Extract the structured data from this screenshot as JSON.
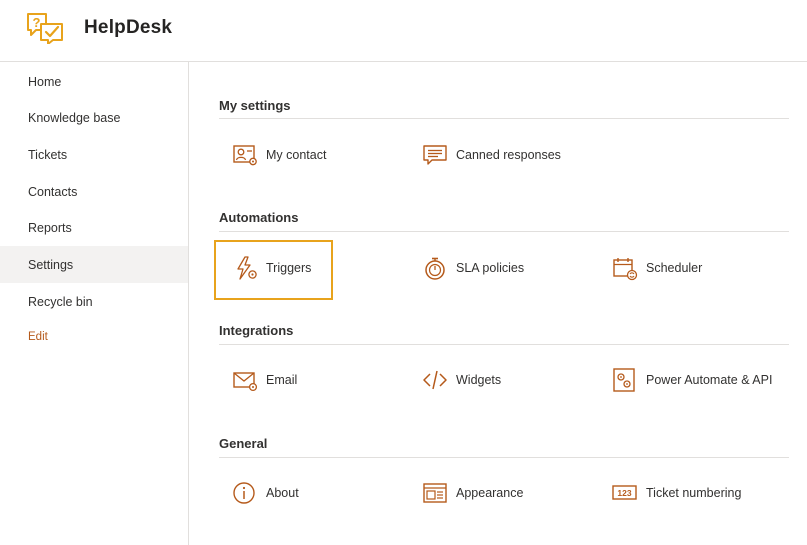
{
  "app": {
    "title": "HelpDesk"
  },
  "sidebar": {
    "items": [
      {
        "label": "Home"
      },
      {
        "label": "Knowledge base"
      },
      {
        "label": "Tickets"
      },
      {
        "label": "Contacts"
      },
      {
        "label": "Reports"
      },
      {
        "label": "Settings"
      },
      {
        "label": "Recycle bin"
      }
    ],
    "edit_label": "Edit",
    "active_item": "Settings"
  },
  "sections": {
    "my_settings": {
      "title": "My settings",
      "tiles": [
        {
          "label": "My contact",
          "icon": "contact-card-icon"
        },
        {
          "label": "Canned responses",
          "icon": "chat-message-icon"
        }
      ]
    },
    "automations": {
      "title": "Automations",
      "tiles": [
        {
          "label": "Triggers",
          "icon": "lightning-gear-icon"
        },
        {
          "label": "SLA policies",
          "icon": "stopwatch-icon"
        },
        {
          "label": "Scheduler",
          "icon": "calendar-refresh-icon"
        }
      ],
      "selected_tile": "Triggers"
    },
    "integrations": {
      "title": "Integrations",
      "tiles": [
        {
          "label": "Email",
          "icon": "mail-gear-icon"
        },
        {
          "label": "Widgets",
          "icon": "code-icon"
        },
        {
          "label": "Power Automate & API",
          "icon": "app-gear-icon"
        }
      ]
    },
    "general": {
      "title": "General",
      "tiles": [
        {
          "label": "About",
          "icon": "info-icon"
        },
        {
          "label": "Appearance",
          "icon": "layout-icon"
        },
        {
          "label": "Ticket numbering",
          "icon": "number-123-icon"
        }
      ]
    }
  },
  "colors": {
    "accent": "#b55a1b",
    "logo": "#e8a31c",
    "selected_border": "#e8a31c",
    "active_nav_bg": "#f3f2f1"
  }
}
